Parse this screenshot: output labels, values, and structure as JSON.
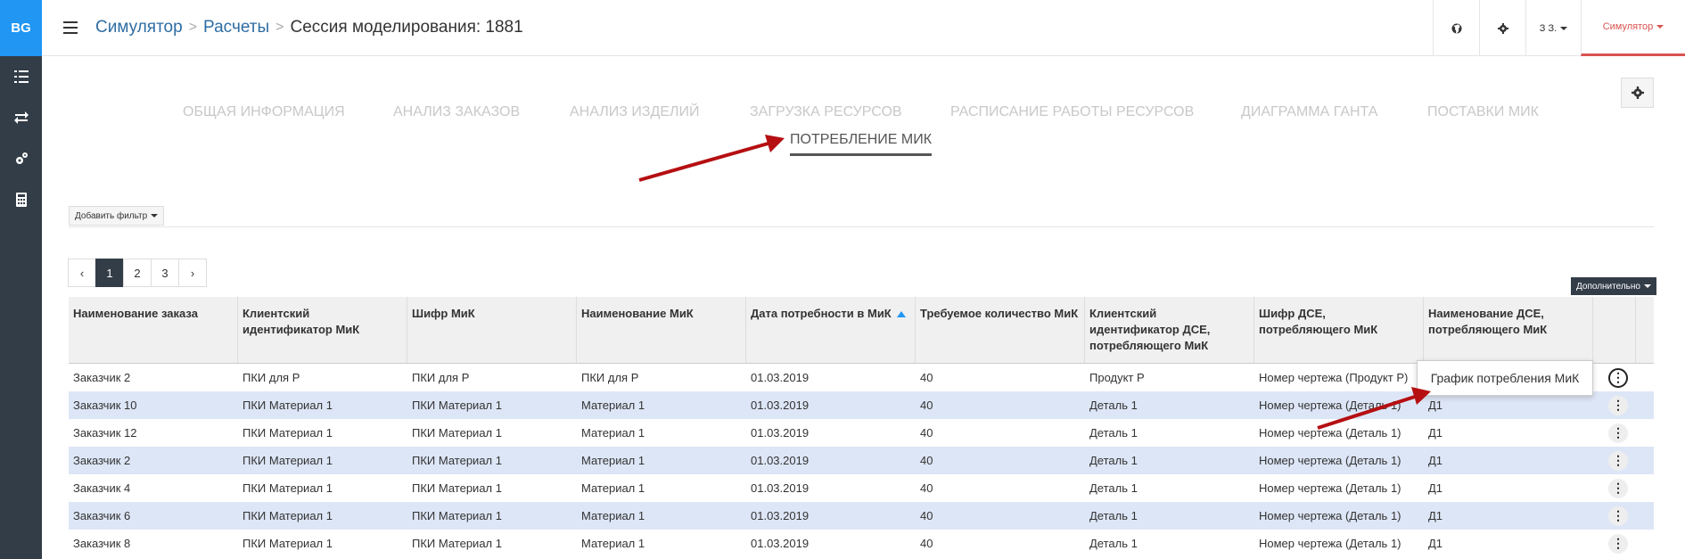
{
  "app": {
    "logo": "BG"
  },
  "breadcrumb": {
    "items": [
      "Симулятор",
      "Расчеты"
    ],
    "current": "Сессия моделирования: 1881"
  },
  "header": {
    "user": "З З.",
    "module": "Симулятор"
  },
  "tabs": [
    "ОБЩАЯ ИНФОРМАЦИЯ",
    "АНАЛИЗ ЗАКАЗОВ",
    "АНАЛИЗ ИЗДЕЛИЙ",
    "ЗАГРУЗКА РЕСУРСОВ",
    "РАСПИСАНИЕ РАБОТЫ РЕСУРСОВ",
    "ДИАГРАММА ГАНТА",
    "ПОСТАВКИ МИК"
  ],
  "active_tab": "ПОТРЕБЛЕНИЕ МИК",
  "filter": {
    "add_label": "Добавить фильтр"
  },
  "pagination": {
    "prev": "‹",
    "next": "›",
    "pages": [
      "1",
      "2",
      "3"
    ],
    "current": "1"
  },
  "more_label": "Дополнительно",
  "table": {
    "columns": [
      "Наименование заказа",
      "Клиентский идентификатор МиК",
      "Шифр МиК",
      "Наименование МиК",
      "Дата потребности в МиК",
      "Требуемое количество МиК",
      "Клиентский идентификатор ДСЕ, потребляющего МиК",
      "Шифр ДСЕ, потребляющего МиК",
      "Наименование ДСЕ, потребляющего МиК"
    ],
    "rows": [
      [
        "Заказчик 2",
        "ПКИ для Р",
        "ПКИ для Р",
        "ПКИ для Р",
        "01.03.2019",
        "40",
        "Продукт Р",
        "Номер чертежа (Продукт Р)",
        ""
      ],
      [
        "Заказчик 10",
        "ПКИ Материал 1",
        "ПКИ Материал 1",
        "Материал 1",
        "01.03.2019",
        "40",
        "Деталь 1",
        "Номер чертежа (Деталь 1)",
        "Д1"
      ],
      [
        "Заказчик 12",
        "ПКИ Материал 1",
        "ПКИ Материал 1",
        "Материал 1",
        "01.03.2019",
        "40",
        "Деталь 1",
        "Номер чертежа (Деталь 1)",
        "Д1"
      ],
      [
        "Заказчик 2",
        "ПКИ Материал 1",
        "ПКИ Материал 1",
        "Материал 1",
        "01.03.2019",
        "40",
        "Деталь 1",
        "Номер чертежа (Деталь 1)",
        "Д1"
      ],
      [
        "Заказчик 4",
        "ПКИ Материал 1",
        "ПКИ Материал 1",
        "Материал 1",
        "01.03.2019",
        "40",
        "Деталь 1",
        "Номер чертежа (Деталь 1)",
        "Д1"
      ],
      [
        "Заказчик 6",
        "ПКИ Материал 1",
        "ПКИ Материал 1",
        "Материал 1",
        "01.03.2019",
        "40",
        "Деталь 1",
        "Номер чертежа (Деталь 1)",
        "Д1"
      ],
      [
        "Заказчик 8",
        "ПКИ Материал 1",
        "ПКИ Материал 1",
        "Материал 1",
        "01.03.2019",
        "40",
        "Деталь 1",
        "Номер чертежа (Деталь 1)",
        "Д1"
      ]
    ]
  },
  "popup": {
    "label": "График потребления МиК"
  },
  "colors": {
    "accent": "#2196f3",
    "sidebar": "#333d48",
    "module": "#d9534f",
    "row_alt": "#dde6f6",
    "annotation_arrow": "#b50f12"
  }
}
